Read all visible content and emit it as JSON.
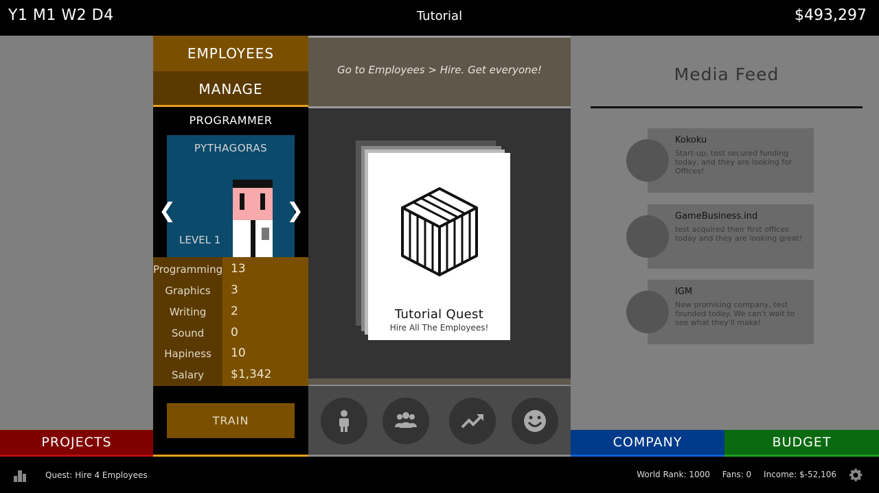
{
  "header": {
    "date": "Y1 M1 W2 D4",
    "title": "Tutorial",
    "money": "$493,297"
  },
  "employees_panel": {
    "employees_label": "EMPLOYEES",
    "manage_label": "MANAGE",
    "role": "PROGRAMMER",
    "name": "PYTHAGORAS",
    "level": "LEVEL 1",
    "stats": [
      {
        "label": "Programming",
        "value": "13"
      },
      {
        "label": "Graphics",
        "value": "3"
      },
      {
        "label": "Writing",
        "value": "2"
      },
      {
        "label": "Sound",
        "value": "0"
      },
      {
        "label": "Hapiness",
        "value": "10"
      },
      {
        "label": "Salary",
        "value": "$1,342"
      }
    ],
    "train_label": "TRAIN"
  },
  "hint": {
    "text": "Go to Employees > Hire. Get everyone!"
  },
  "card": {
    "title": "Tutorial Quest",
    "subtitle": "Hire All The Employees!"
  },
  "action_icons": [
    "person-icon",
    "group-icon",
    "trending-up-icon",
    "smiley-icon"
  ],
  "media_feed": {
    "title": "Media Feed",
    "items": [
      {
        "name": "Kokoku",
        "text": "Start-up, test secured funding today, and they are looking for Offices!"
      },
      {
        "name": "GameBusiness.ind",
        "text": "test acquired their first offices today and they are looking great!"
      },
      {
        "name": "IGM",
        "text": "New promising company, test founded today. We can't wait to see what they'll make!"
      }
    ]
  },
  "tabs": {
    "projects": "PROJECTS",
    "company": "COMPANY",
    "budget": "BUDGET"
  },
  "status": {
    "quest": "Quest: Hire 4 Employees",
    "world_rank": "World Rank: 1000",
    "fans": "Fans: 0",
    "income": "Income:  $-52,106"
  },
  "colors": {
    "employees_accent": "#7a5000",
    "projects": "#800000",
    "company": "#003a8a",
    "budget": "#0a6a10",
    "portrait_bg": "#0b4a6b"
  }
}
